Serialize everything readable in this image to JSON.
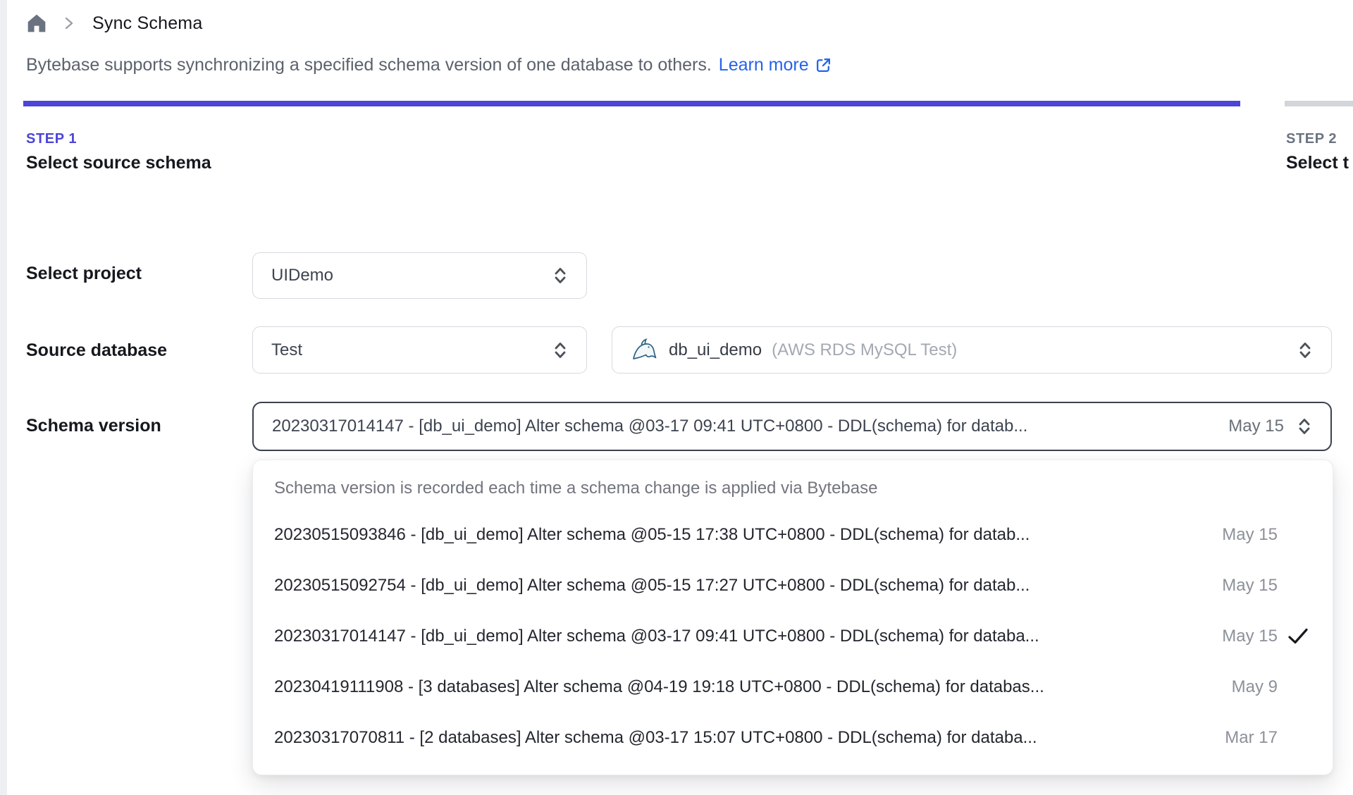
{
  "breadcrumb": {
    "home_icon": "home-icon",
    "title": "Sync Schema"
  },
  "intro": {
    "text": "Bytebase supports synchronizing a specified schema version of one database to others.",
    "link_label": "Learn more",
    "link_icon": "external-link-icon"
  },
  "progress": {
    "active_color": "#4c45d6",
    "inactive_color": "#d2d5da"
  },
  "steps": [
    {
      "label": "STEP 1",
      "title": "Select source schema",
      "state": "active"
    },
    {
      "label": "STEP 2",
      "title": "Select t",
      "state": "upcoming"
    }
  ],
  "form": {
    "project": {
      "label": "Select project",
      "value": "UIDemo"
    },
    "source_database": {
      "label": "Source database",
      "environment_value": "Test",
      "database_icon": "mysql-dolphin-icon",
      "database_name": "db_ui_demo",
      "database_detail": "(AWS RDS MySQL Test)"
    },
    "schema_version": {
      "label": "Schema version",
      "value": "20230317014147 - [db_ui_demo] Alter schema @03-17 09:41 UTC+0800 - DDL(schema) for datab...",
      "date": "May 15"
    }
  },
  "dropdown": {
    "hint": "Schema version is recorded each time a schema change is applied via Bytebase",
    "options": [
      {
        "text": "20230515093846 - [db_ui_demo] Alter schema @05-15 17:38 UTC+0800 - DDL(schema) for datab...",
        "date": "May 15",
        "selected": false
      },
      {
        "text": "20230515092754 - [db_ui_demo] Alter schema @05-15 17:27 UTC+0800 - DDL(schema) for datab...",
        "date": "May 15",
        "selected": false
      },
      {
        "text": "20230317014147 - [db_ui_demo] Alter schema @03-17 09:41 UTC+0800 - DDL(schema) for databa...",
        "date": "May 15",
        "selected": true
      },
      {
        "text": "20230419111908 - [3 databases] Alter schema @04-19 19:18 UTC+0800 - DDL(schema) for databas...",
        "date": "May 9",
        "selected": false
      },
      {
        "text": "20230317070811 - [2 databases] Alter schema @03-17 15:07 UTC+0800 - DDL(schema) for databa...",
        "date": "Mar 17",
        "selected": false
      }
    ]
  },
  "colors": {
    "accent_indigo": "#4c45d6",
    "link_blue": "#2563eb",
    "focus_border": "#3a4150",
    "border_gray": "#d6d9de",
    "text_dark": "#15181d",
    "text_gray": "#6b7280"
  }
}
